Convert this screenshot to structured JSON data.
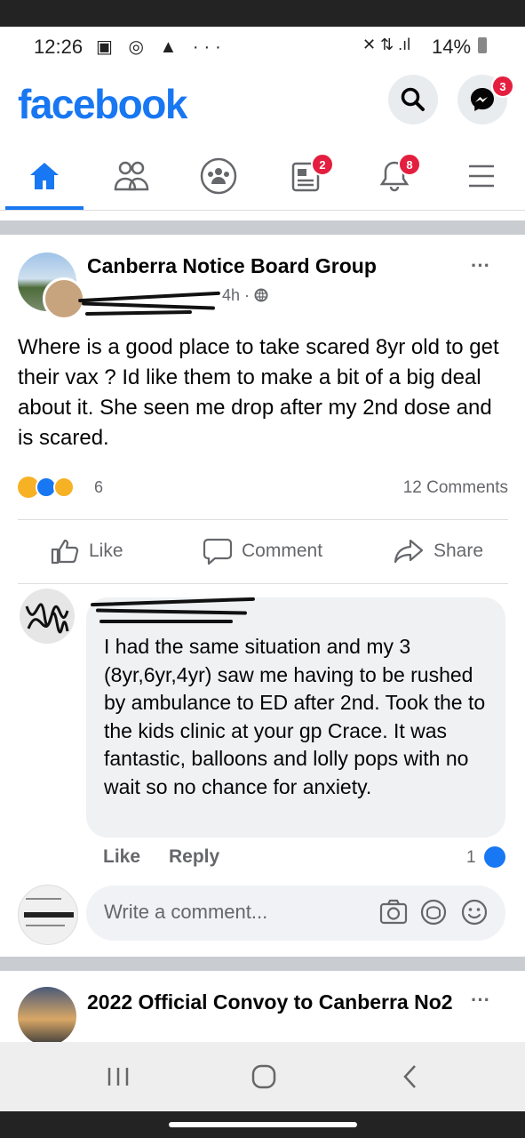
{
  "status_bar": {
    "time": "12:26",
    "battery": "14%",
    "left_icons": "▣ ◎ ▲ ···",
    "signal": "✕ ⇅ .ıl"
  },
  "header": {
    "logo": "facebook",
    "messenger_badge": "3"
  },
  "nav": {
    "items": [
      {
        "name": "home",
        "badge": ""
      },
      {
        "name": "friends",
        "badge": ""
      },
      {
        "name": "groups",
        "badge": ""
      },
      {
        "name": "news",
        "badge": "2"
      },
      {
        "name": "notifications",
        "badge": "8"
      },
      {
        "name": "menu",
        "badge": ""
      }
    ]
  },
  "post": {
    "group_name": "Canberra Notice Board Group",
    "time": "4h · ",
    "more": "···",
    "text": "Where is a good place to take scared 8yr old to get their vax ? Id like them to make a bit of a big deal about it. She seen me drop after my 2nd dose and is scared.",
    "reaction_count": "6",
    "comments_count": "12 Comments",
    "actions": {
      "like": "Like",
      "comment": "Comment",
      "share": "Share"
    }
  },
  "comment": {
    "text": "I had the same situation and my 3 (8yr,6yr,4yr) saw me having to be rushed by ambulance to ED after 2nd. Took the to the kids clinic at your gp Crace. It was fantastic, balloons and lolly pops with no wait so no chance for anxiety.",
    "like_label": "Like",
    "reply_label": "Reply",
    "like_count": "1"
  },
  "write_comment": {
    "placeholder": "Write a comment..."
  },
  "next_post": {
    "title": "2022 Official Convoy to Canberra No2",
    "more": "···"
  },
  "colors": {
    "brand": "#1877f2",
    "badge": "#e41e3f"
  }
}
